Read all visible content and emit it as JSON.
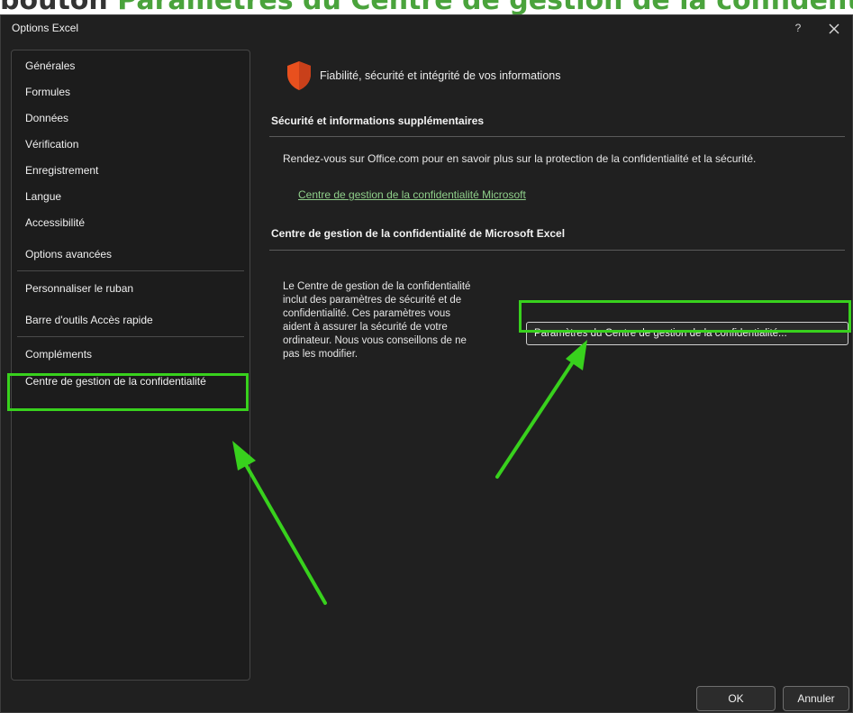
{
  "page_heading": {
    "prefix": "bouton ",
    "accent": "Paramètres du Centre de gestion de la confidentialité"
  },
  "dialog": {
    "title": "Options Excel",
    "help_label": "?"
  },
  "sidebar": {
    "items": [
      {
        "label": "Générales"
      },
      {
        "label": "Formules"
      },
      {
        "label": "Données"
      },
      {
        "label": "Vérification"
      },
      {
        "label": "Enregistrement"
      },
      {
        "label": "Langue"
      },
      {
        "label": "Accessibilité"
      },
      {
        "label": "Options avancées"
      },
      {
        "label": "Personnaliser le ruban"
      },
      {
        "label": "Barre d'outils Accès rapide"
      },
      {
        "label": "Compléments"
      },
      {
        "label": "Centre de gestion de la confidentialité"
      }
    ],
    "selected_index": 11
  },
  "main": {
    "header": "Fiabilité, sécurité et intégrité de vos informations",
    "security_section": {
      "title": "Sécurité et informations supplémentaires",
      "text": "Rendez-vous sur Office.com pour en savoir plus sur la protection de la confidentialité et la sécurité.",
      "link": "Centre de gestion de la confidentialité Microsoft"
    },
    "trust_center_section": {
      "title": "Centre de gestion de la confidentialité de Microsoft Excel",
      "lines": [
        "Le Centre de gestion de la confidentialité",
        "inclut des paramètres de sécurité et de",
        "confidentialité. Ces paramètres vous",
        "aident à assurer la sécurité de votre",
        "ordinateur. Nous vous conseillons de ne",
        "pas les modifier."
      ],
      "button": "Paramètres du Centre de gestion de la confidentialité..."
    }
  },
  "footer": {
    "ok": "OK",
    "cancel": "Annuler"
  },
  "colors": {
    "highlight": "#38d11d",
    "shield": "#e8501e",
    "dialog_background": "#202020",
    "link": "#8fcf8a"
  },
  "icons": {
    "shield": "shield-icon",
    "close": "close-icon",
    "help": "help-icon"
  }
}
